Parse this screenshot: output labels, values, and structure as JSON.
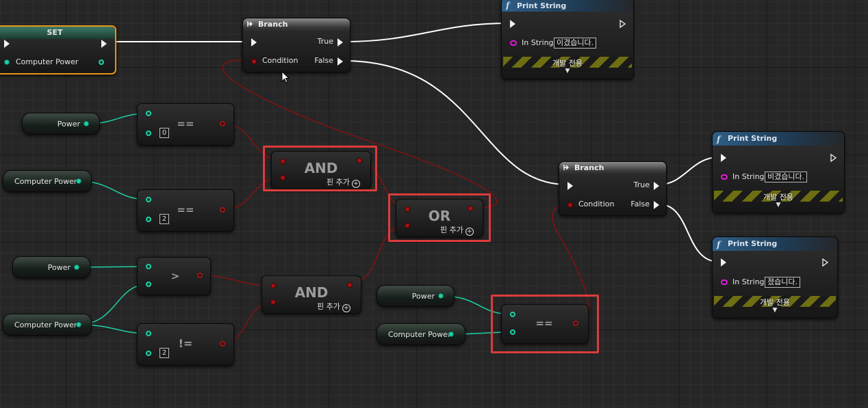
{
  "set_node": {
    "title": "SET",
    "pin_label": "Computer Power"
  },
  "branch_1": {
    "title": "Branch",
    "true_label": "True",
    "false_label": "False",
    "condition_label": "Condition"
  },
  "branch_2": {
    "title": "Branch",
    "true_label": "True",
    "false_label": "False",
    "condition_label": "Condition"
  },
  "print_1": {
    "title": "Print String",
    "in_string_label": "In String",
    "in_string_value": "이겼습니다.",
    "dev_only": "개발 전용"
  },
  "print_2": {
    "title": "Print String",
    "in_string_label": "In String",
    "in_string_value": "비겼습니다.",
    "dev_only": "개발 전용"
  },
  "print_3": {
    "title": "Print String",
    "in_string_label": "In String",
    "in_string_value": "졌습니다.",
    "dev_only": "개발 전용"
  },
  "var_power_1": {
    "label": "Power"
  },
  "var_cp_1": {
    "label": "Computer Power"
  },
  "var_power_2": {
    "label": "Power"
  },
  "var_cp_2": {
    "label": "Computer Power"
  },
  "var_power_3": {
    "label": "Power"
  },
  "var_cp_3": {
    "label": "Computer Power"
  },
  "eq_1": {
    "op": "==",
    "value": "0"
  },
  "eq_2": {
    "op": "==",
    "value": "2"
  },
  "gt_1": {
    "op": ">"
  },
  "ne_1": {
    "op": "!=",
    "value": "2"
  },
  "and_1": {
    "title": "AND",
    "add_pin": "핀 추가"
  },
  "and_2": {
    "title": "AND",
    "add_pin": "핀 추가"
  },
  "or_1": {
    "title": "OR",
    "add_pin": "핀 추가"
  },
  "eq_3": {
    "op": "=="
  },
  "colors": {
    "exec_wire": "#ffffff",
    "bool_wire": "#8f0f0f",
    "int_wire": "#1cd1a6",
    "highlight": "#dd3b3b",
    "set_border": "#e8951b"
  }
}
